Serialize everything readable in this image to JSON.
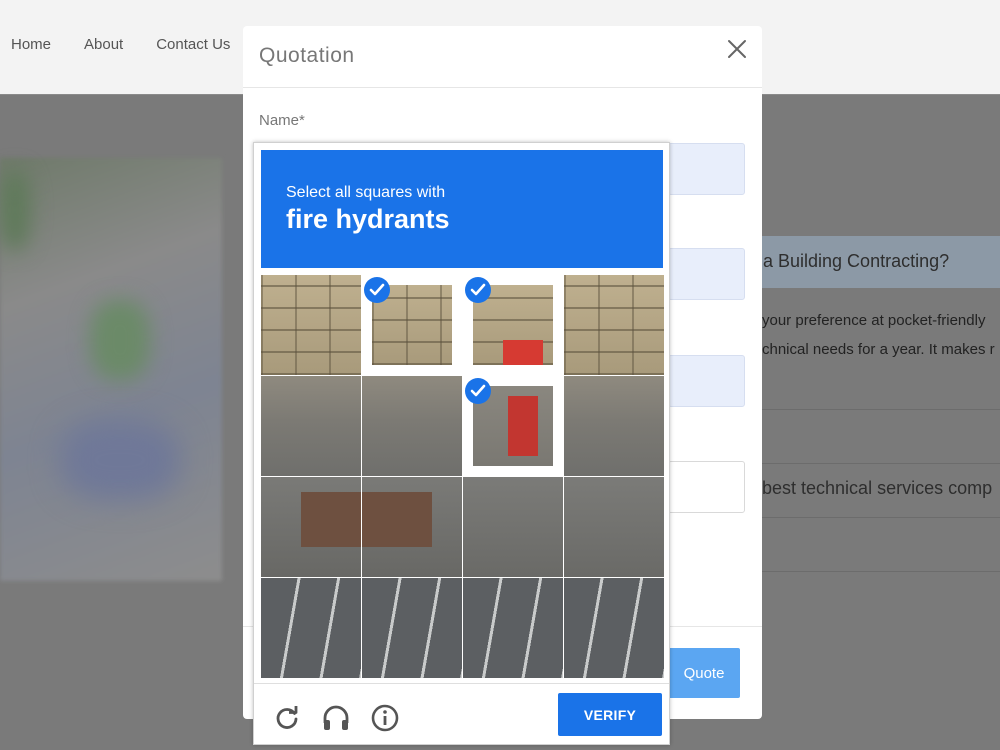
{
  "nav": {
    "items": [
      "Home",
      "About",
      "Contact Us"
    ]
  },
  "page": {
    "accordion_title": "a Building Contracting?",
    "accordion_line1": "your preference at pocket-friendly",
    "accordion_line2": "chnical needs for a year. It makes r",
    "accordion_item": "best technical services comp"
  },
  "modal": {
    "title": "Quotation",
    "name_label": "Name*",
    "submit_label": "Quote"
  },
  "captcha": {
    "instruction": "Select all squares with",
    "target": "fire hydrants",
    "verify_label": "VERIFY",
    "icons": [
      "reload-icon",
      "audio-headphones-icon",
      "info-icon"
    ],
    "accent_color": "#1a73e8",
    "grid_rows": 4,
    "grid_cols": 4,
    "selected_tiles": [
      1,
      2,
      6
    ]
  }
}
